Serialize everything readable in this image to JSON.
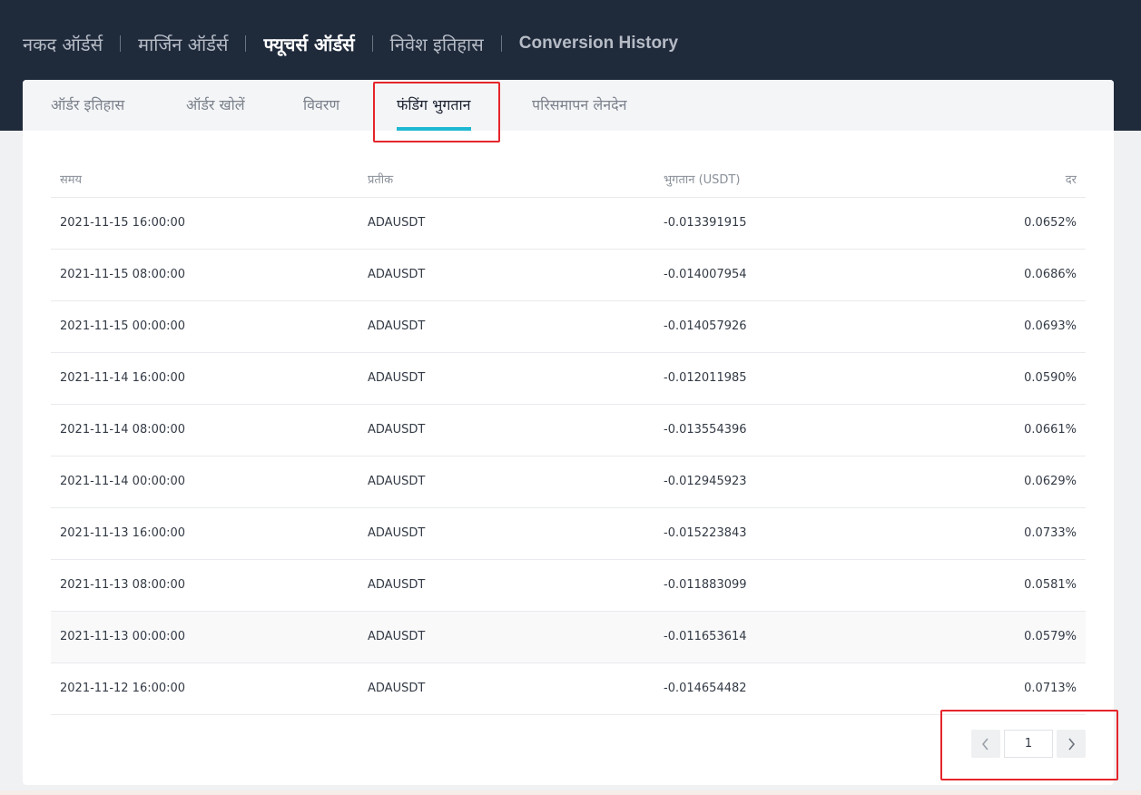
{
  "top_nav": [
    {
      "label": "नकद ऑर्डर्स",
      "active": false
    },
    {
      "label": "मार्जिन ऑर्डर्स",
      "active": false
    },
    {
      "label": "फ्यूचर्स ऑर्डर्स",
      "active": true
    },
    {
      "label": "निवेश इतिहास",
      "active": false
    },
    {
      "label": "Conversion History",
      "active": false
    }
  ],
  "tabs": [
    {
      "label": "ऑर्डर इतिहास"
    },
    {
      "label": "ऑर्डर खोलें"
    },
    {
      "label": "विवरण"
    },
    {
      "label": "फंडिंग भुगतान",
      "active": true
    },
    {
      "label": "परिसमापन लेनदेन"
    }
  ],
  "table": {
    "headers": {
      "time": "समय",
      "symbol": "प्रतीक",
      "payment": "भुगतान (USDT)",
      "rate": "दर"
    },
    "rows": [
      {
        "time": "2021-11-15 16:00:00",
        "symbol": "ADAUSDT",
        "payment": "-0.013391915",
        "rate": "0.0652%"
      },
      {
        "time": "2021-11-15 08:00:00",
        "symbol": "ADAUSDT",
        "payment": "-0.014007954",
        "rate": "0.0686%"
      },
      {
        "time": "2021-11-15 00:00:00",
        "symbol": "ADAUSDT",
        "payment": "-0.014057926",
        "rate": "0.0693%"
      },
      {
        "time": "2021-11-14 16:00:00",
        "symbol": "ADAUSDT",
        "payment": "-0.012011985",
        "rate": "0.0590%"
      },
      {
        "time": "2021-11-14 08:00:00",
        "symbol": "ADAUSDT",
        "payment": "-0.013554396",
        "rate": "0.0661%"
      },
      {
        "time": "2021-11-14 00:00:00",
        "symbol": "ADAUSDT",
        "payment": "-0.012945923",
        "rate": "0.0629%"
      },
      {
        "time": "2021-11-13 16:00:00",
        "symbol": "ADAUSDT",
        "payment": "-0.015223843",
        "rate": "0.0733%"
      },
      {
        "time": "2021-11-13 08:00:00",
        "symbol": "ADAUSDT",
        "payment": "-0.011883099",
        "rate": "0.0581%"
      },
      {
        "time": "2021-11-13 00:00:00",
        "symbol": "ADAUSDT",
        "payment": "-0.011653614",
        "rate": "0.0579%"
      },
      {
        "time": "2021-11-12 16:00:00",
        "symbol": "ADAUSDT",
        "payment": "-0.014654482",
        "rate": "0.0713%"
      }
    ]
  },
  "pagination": {
    "current_page": "1",
    "prev_icon": "chevron-left-icon",
    "next_icon": "chevron-right-icon"
  },
  "colors": {
    "header_bg": "#1f2a3b",
    "tab_underline": "#1fb8d2",
    "highlight_box": "#e5252a"
  }
}
